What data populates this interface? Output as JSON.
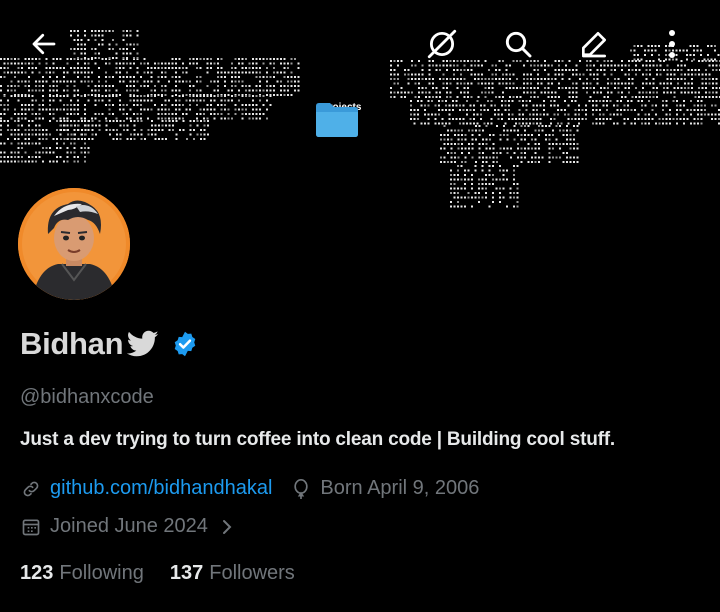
{
  "header": {
    "back_icon": "arrow-left-icon",
    "action_icons": [
      "grok-icon",
      "search-icon",
      "edit-icon",
      "more-vertical-icon"
    ]
  },
  "banner": {
    "folder_label": "projects",
    "folder_color": "#4fb0e8"
  },
  "profile": {
    "display_name": "Bidhan",
    "name_badge_icon": "twitter-bird-icon",
    "verified_icon": "verified-badge-icon",
    "handle": "@bidhanxcode",
    "bio": "Just a dev trying to turn coffee into clean code | Building cool stuff.",
    "website": "github.com/bidhandhakal",
    "born": "Born April 9, 2006",
    "joined": "Joined June 2024",
    "following_count": "123",
    "following_label": "Following",
    "followers_count": "137",
    "followers_label": "Followers"
  },
  "colors": {
    "accent": "#1d9bf0",
    "muted": "#71767b",
    "text": "#e7e9ea",
    "background": "#000000"
  }
}
